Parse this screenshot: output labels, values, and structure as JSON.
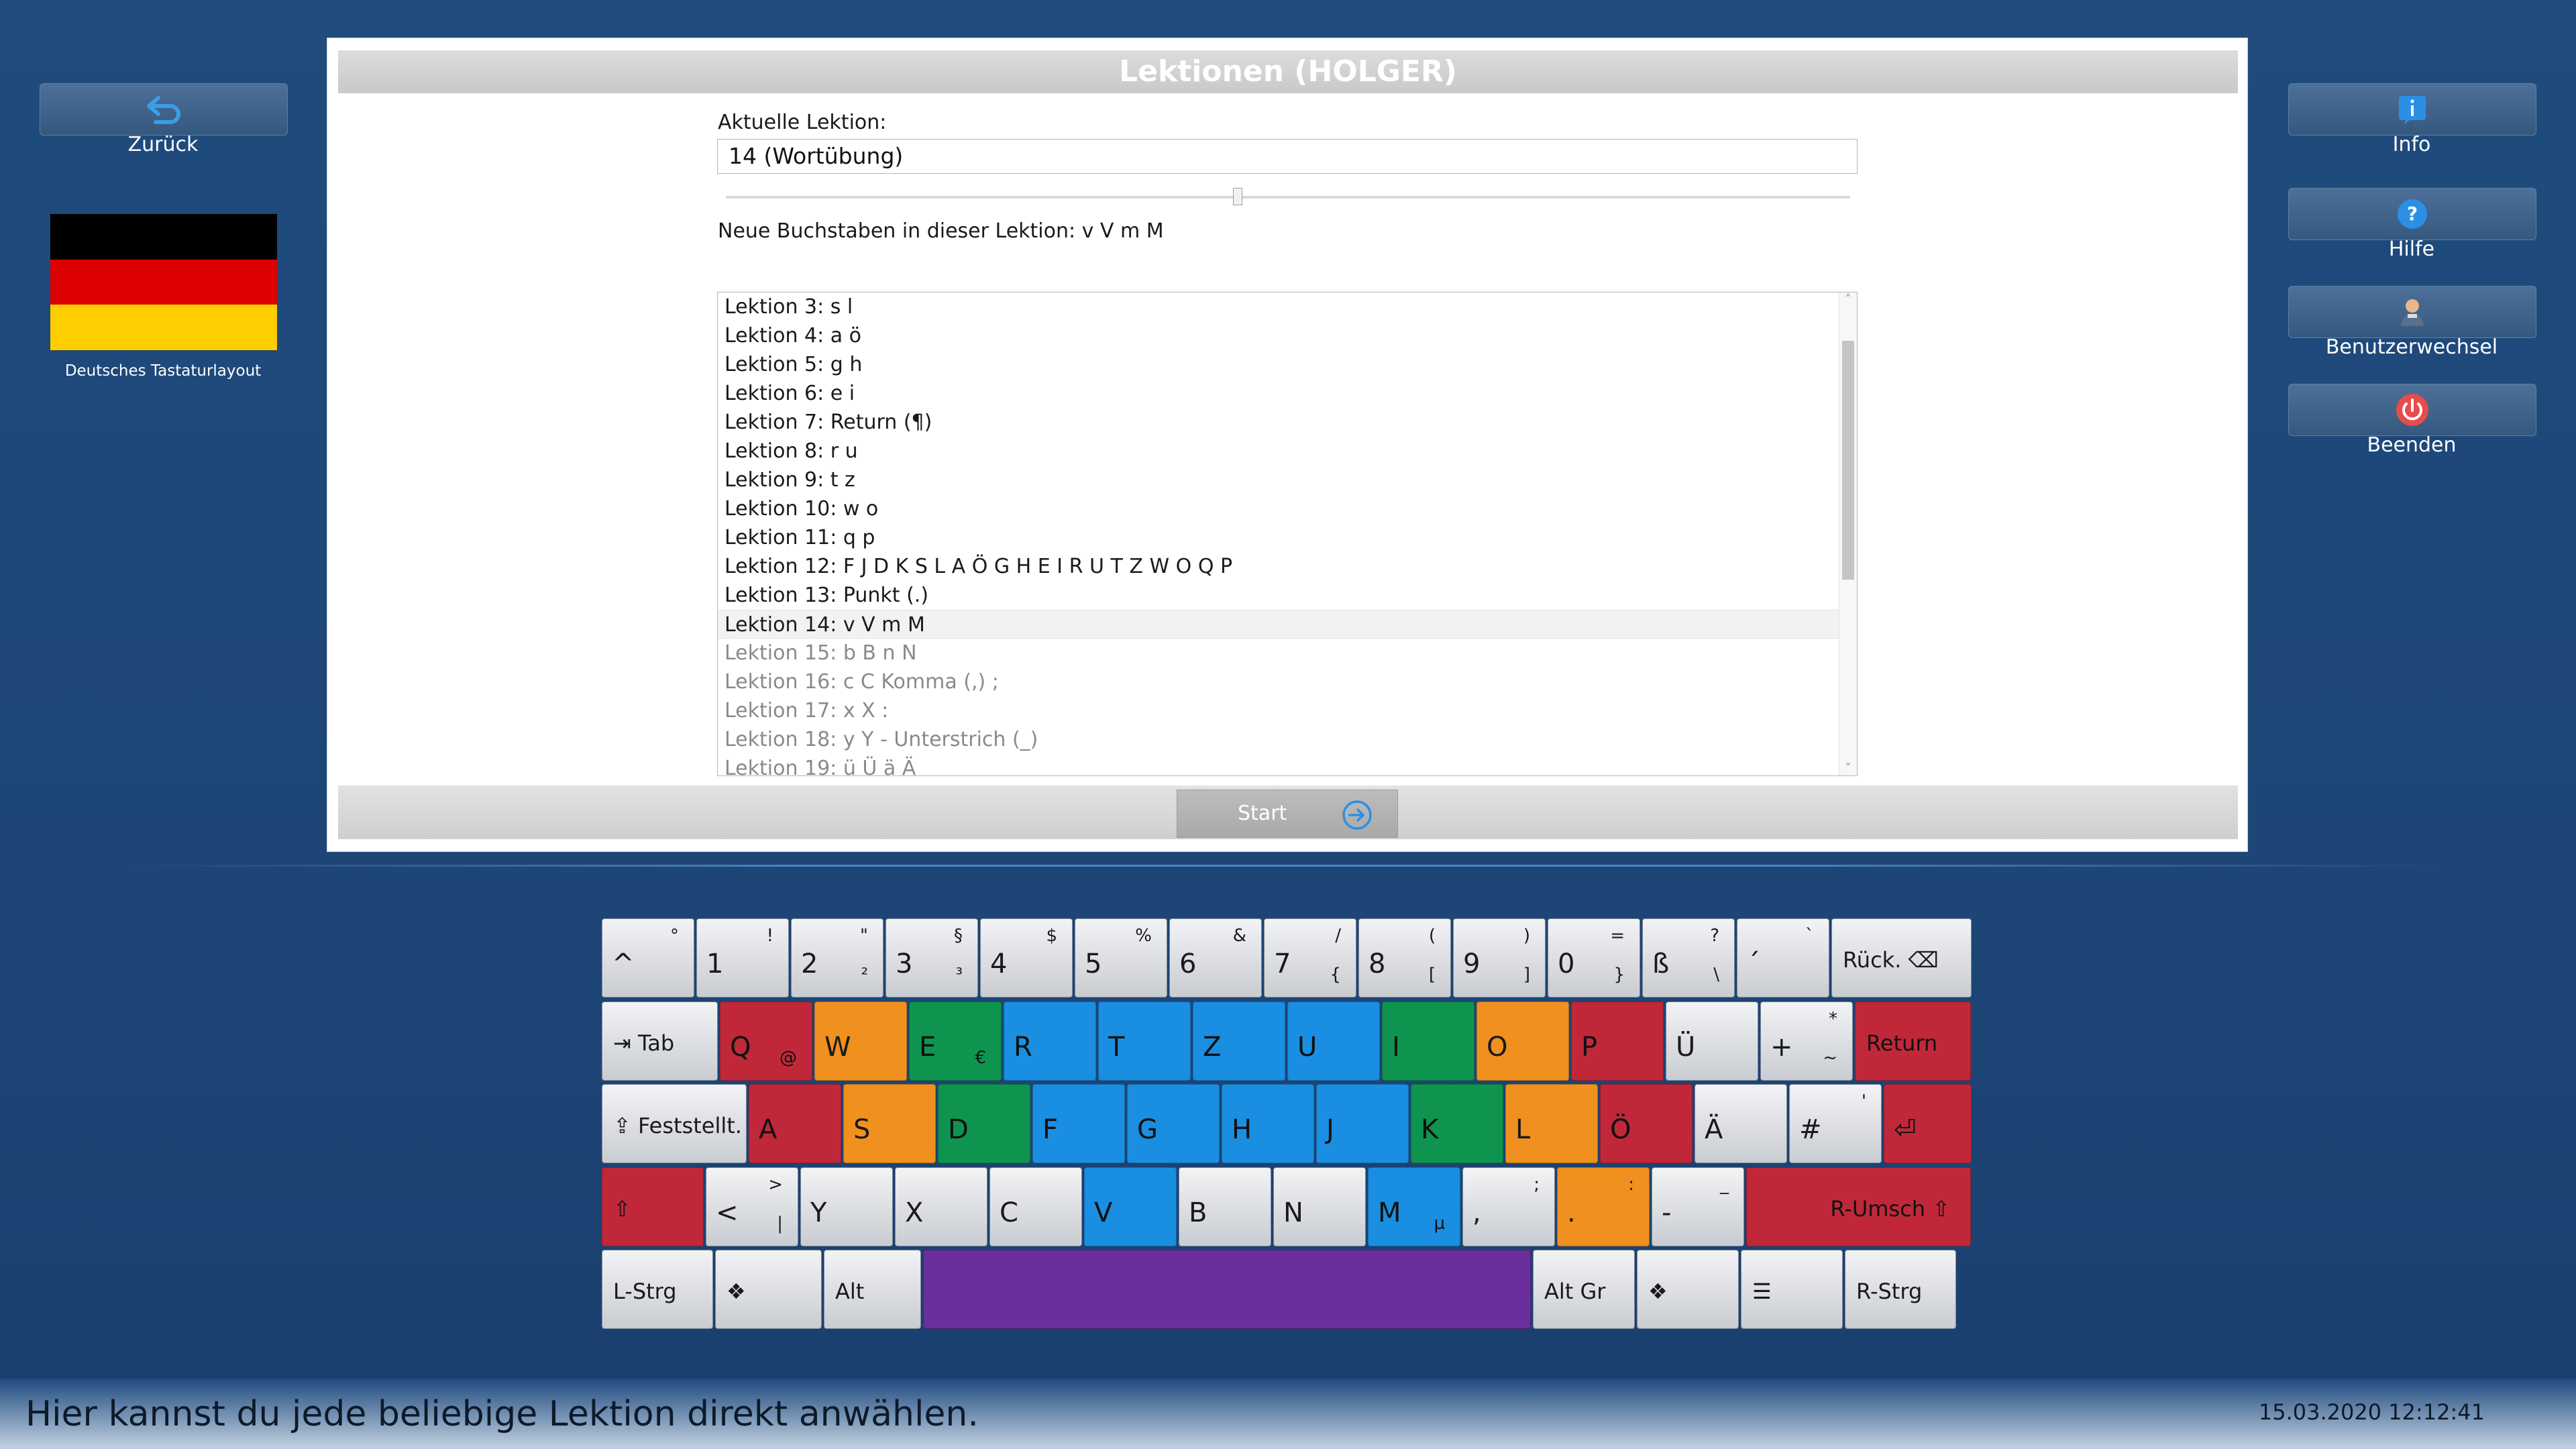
{
  "left": {
    "back_label": "Zurück",
    "layout_label": "Deutsches Tastaturlayout"
  },
  "right": {
    "info_label": "Info",
    "help_label": "Hilfe",
    "switch_user_label": "Benutzerwechsel",
    "quit_label": "Beenden"
  },
  "panel": {
    "title": "Lektionen (HOLGER)",
    "current_label": "Aktuelle Lektion:",
    "current_value": "14 (Wortübung)",
    "new_letters": "Neue Buchstaben in dieser Lektion: v V m M",
    "start_label": "Start",
    "lessons": [
      {
        "text": "Lektion 3: s l",
        "state": "done"
      },
      {
        "text": "Lektion 4: a ö",
        "state": "done"
      },
      {
        "text": "Lektion 5: g h",
        "state": "done"
      },
      {
        "text": "Lektion 6: e i",
        "state": "done"
      },
      {
        "text": "Lektion 7: Return (¶)",
        "state": "done"
      },
      {
        "text": "Lektion 8: r u",
        "state": "done"
      },
      {
        "text": "Lektion 9: t z",
        "state": "done"
      },
      {
        "text": "Lektion 10: w o",
        "state": "done"
      },
      {
        "text": "Lektion 11: q p",
        "state": "done"
      },
      {
        "text": "Lektion 12: F J D K S L A Ö G H E I R U T Z W O Q P",
        "state": "done"
      },
      {
        "text": "Lektion 13: Punkt (.)",
        "state": "done"
      },
      {
        "text": "Lektion 14: v V m M",
        "state": "selected"
      },
      {
        "text": "Lektion 15: b B n N",
        "state": "locked"
      },
      {
        "text": "Lektion 16: c C Komma (,) ;",
        "state": "locked"
      },
      {
        "text": "Lektion 17: x X :",
        "state": "locked"
      },
      {
        "text": "Lektion 18: y Y - Unterstrich (_)",
        "state": "locked"
      },
      {
        "text": "Lektion 19: ü Ü ä Ä",
        "state": "locked"
      }
    ]
  },
  "keyboard": {
    "colors": {
      "red": "#c0283a",
      "orange": "#f0901e",
      "green": "#0f9450",
      "blue": "#1a8ee0",
      "gray": "#d6d9dd",
      "purple": "#6a2f9a"
    },
    "rows": [
      [
        {
          "m": "^",
          "s": "°",
          "c": "gray",
          "w": 1
        },
        {
          "m": "1",
          "s": "!",
          "c": "gray",
          "w": 1
        },
        {
          "m": "2",
          "s": "\"",
          "a": "²",
          "c": "gray",
          "w": 1
        },
        {
          "m": "3",
          "s": "§",
          "a": "³",
          "c": "gray",
          "w": 1
        },
        {
          "m": "4",
          "s": "$",
          "c": "gray",
          "w": 1
        },
        {
          "m": "5",
          "s": "%",
          "c": "gray",
          "w": 1
        },
        {
          "m": "6",
          "s": "&",
          "c": "gray",
          "w": 1
        },
        {
          "m": "7",
          "s": "/",
          "a": "{",
          "c": "gray",
          "w": 1
        },
        {
          "m": "8",
          "s": "(",
          "a": "[",
          "c": "gray",
          "w": 1
        },
        {
          "m": "9",
          "s": ")",
          "a": "]",
          "c": "gray",
          "w": 1
        },
        {
          "m": "0",
          "s": "=",
          "a": "}",
          "c": "gray",
          "w": 1
        },
        {
          "m": "ß",
          "s": "?",
          "a": "\\",
          "c": "gray",
          "w": 1
        },
        {
          "m": "´",
          "s": "`",
          "c": "gray",
          "w": 1
        },
        {
          "word": "Rück.  ⌫",
          "c": "gray",
          "w": 1.5
        }
      ],
      [
        {
          "word": "⇥ Tab",
          "c": "gray",
          "w": 1.25
        },
        {
          "m": "Q",
          "a": "@",
          "c": "red",
          "w": 1
        },
        {
          "m": "W",
          "c": "orange",
          "w": 1
        },
        {
          "m": "E",
          "a": "€",
          "c": "green",
          "w": 1
        },
        {
          "m": "R",
          "c": "blue",
          "w": 1
        },
        {
          "m": "T",
          "c": "blue",
          "w": 1
        },
        {
          "m": "Z",
          "c": "blue",
          "w": 1
        },
        {
          "m": "U",
          "c": "blue",
          "w": 1
        },
        {
          "m": "I",
          "c": "green",
          "w": 1
        },
        {
          "m": "O",
          "c": "orange",
          "w": 1
        },
        {
          "m": "P",
          "c": "red",
          "w": 1
        },
        {
          "m": "Ü",
          "c": "gray",
          "w": 1
        },
        {
          "m": "+",
          "s": "*",
          "a": "~",
          "c": "gray",
          "w": 1
        },
        {
          "word": "Return",
          "c": "red",
          "w": 1.25
        }
      ],
      [
        {
          "word": "⇪ Feststellt.",
          "c": "gray",
          "w": 1.55
        },
        {
          "m": "A",
          "c": "red",
          "w": 1
        },
        {
          "m": "S",
          "c": "orange",
          "w": 1
        },
        {
          "m": "D",
          "c": "green",
          "w": 1
        },
        {
          "m": "F",
          "c": "blue",
          "w": 1
        },
        {
          "m": "G",
          "c": "blue",
          "w": 1
        },
        {
          "m": "H",
          "c": "blue",
          "w": 1
        },
        {
          "m": "J",
          "c": "blue",
          "w": 1
        },
        {
          "m": "K",
          "c": "green",
          "w": 1
        },
        {
          "m": "L",
          "c": "orange",
          "w": 1
        },
        {
          "m": "Ö",
          "c": "red",
          "w": 1
        },
        {
          "m": "Ä",
          "c": "gray",
          "w": 1
        },
        {
          "m": "#",
          "s": "'",
          "c": "gray",
          "w": 1
        },
        {
          "m": "⏎",
          "c": "red",
          "w": 0.95
        }
      ],
      [
        {
          "word": "⇧",
          "c": "red",
          "w": 1.1
        },
        {
          "m": "<",
          "s": ">",
          "a": "|",
          "c": "gray",
          "w": 1
        },
        {
          "m": "Y",
          "c": "gray",
          "w": 1
        },
        {
          "m": "X",
          "c": "gray",
          "w": 1
        },
        {
          "m": "C",
          "c": "gray",
          "w": 1
        },
        {
          "m": "V",
          "c": "blue",
          "w": 1
        },
        {
          "m": "B",
          "c": "gray",
          "w": 1
        },
        {
          "m": "N",
          "c": "gray",
          "w": 1
        },
        {
          "m": "M",
          "a": "µ",
          "c": "blue",
          "w": 1
        },
        {
          "m": ",",
          "s": ";",
          "c": "gray",
          "w": 1
        },
        {
          "m": ".",
          "s": ":",
          "c": "orange",
          "w": 1
        },
        {
          "m": "-",
          "s": "_",
          "c": "gray",
          "w": 1
        },
        {
          "word-r": "R-Umsch ⇧",
          "c": "red",
          "w": 2.4
        }
      ],
      [
        {
          "word": "L-Strg",
          "c": "gray",
          "w": 1.2
        },
        {
          "word": "❖",
          "c": "gray",
          "w": 1.15
        },
        {
          "word": "Alt",
          "c": "gray",
          "w": 1.05
        },
        {
          "word": "",
          "c": "purple",
          "w": 6.45
        },
        {
          "word": "Alt Gr",
          "c": "gray",
          "w": 1.1
        },
        {
          "word": "❖",
          "c": "gray",
          "w": 1.1
        },
        {
          "word": "☰",
          "c": "gray",
          "w": 1.1
        },
        {
          "word": "R-Strg",
          "c": "gray",
          "w": 1.2
        }
      ]
    ]
  },
  "status": {
    "message": "Hier kannst du jede beliebige Lektion direkt anwählen.",
    "datetime": "15.03.2020 12:12:41"
  }
}
